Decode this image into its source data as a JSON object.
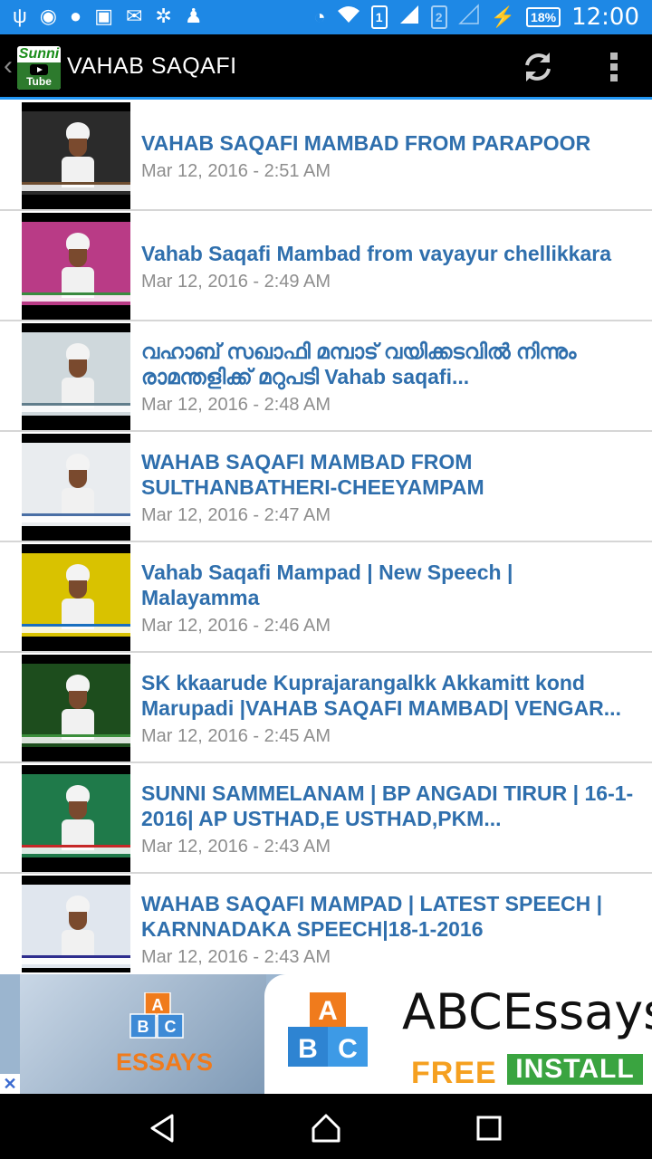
{
  "status_bar": {
    "time": "12:00",
    "battery": "18%",
    "sim2": "2",
    "sim1": "1"
  },
  "app_bar": {
    "logo_text_top": "Sunni",
    "logo_text_bottom": "Tube",
    "title": "VAHAB SAQAFI"
  },
  "videos": [
    {
      "title": "VAHAB SAQAFI MAMBAD FROM PARAPOOR",
      "date": "Mar 12, 2016 - 2:51 AM",
      "thumb_bg": "#2b2b2b",
      "thumb_accent": "#6d4c2f"
    },
    {
      "title": "Vahab Saqafi Mambad from vayayur chellikkara",
      "date": "Mar 12, 2016 - 2:49 AM",
      "thumb_bg": "#b93b86",
      "thumb_accent": "#3a8a40"
    },
    {
      "title": "വഹാബ് സഖാഫി മമ്പാട് വയിക്കടവിൽ നിന്നും രാമന്തളിക്ക് മറുപടി Vahab saqafi...",
      "date": "Mar 12, 2016 - 2:48 AM",
      "thumb_bg": "#cfd8dc",
      "thumb_accent": "#607d8b"
    },
    {
      "title": "WAHAB SAQAFI MAMBAD FROM SULTHANBATHERI-CHEEYAMPAM",
      "date": "Mar 12, 2016 - 2:47 AM",
      "thumb_bg": "#e9ecef",
      "thumb_accent": "#4a6fa5"
    },
    {
      "title": "Vahab Saqafi Mampad | New Speech | Malayamma",
      "date": "Mar 12, 2016 - 2:46 AM",
      "thumb_bg": "#d9c200",
      "thumb_accent": "#1a6fbf"
    },
    {
      "title": "SK kkaarude Kuprajarangalkk Akkamitt kond Marupadi |VAHAB SAQAFI MAMBAD| VENGAR...",
      "date": "Mar 12, 2016 - 2:45 AM",
      "thumb_bg": "#1d4d1d",
      "thumb_accent": "#3b8e3b"
    },
    {
      "title": "SUNNI SAMMELANAM | BP ANGADI TIRUR | 16-1-2016| AP USTHAD,E USTHAD,PKM...",
      "date": "Mar 12, 2016 - 2:43 AM",
      "thumb_bg": "#1f7a4a",
      "thumb_accent": "#c62828"
    },
    {
      "title": "WAHAB SAQAFI MAMPAD | LATEST SPEECH | KARNNADAKA SPEECH|18-1-2016",
      "date": "Mar 12, 2016 - 2:43 AM",
      "thumb_bg": "#e0e6ee",
      "thumb_accent": "#2e2e8e"
    }
  ],
  "ad": {
    "small_blocks": [
      "A",
      "B",
      "C"
    ],
    "small_label": "ESSAYS",
    "big_blocks": [
      "A",
      "B",
      "C"
    ],
    "brand": "ABCEssays",
    "free_label": "FREE",
    "install_label": "INSTALL",
    "close_glyph": "✕"
  },
  "icons": {
    "back": "back-chevron-icon",
    "refresh": "refresh-icon",
    "overflow": "overflow-menu-icon",
    "nav_back": "nav-back-icon",
    "nav_home": "nav-home-icon",
    "nav_recents": "nav-recents-icon"
  },
  "colors": {
    "status_bar": "#1e88e5",
    "accent": "#2196f3",
    "title_text": "#2f6fad",
    "date_text": "#8e8e8e"
  }
}
